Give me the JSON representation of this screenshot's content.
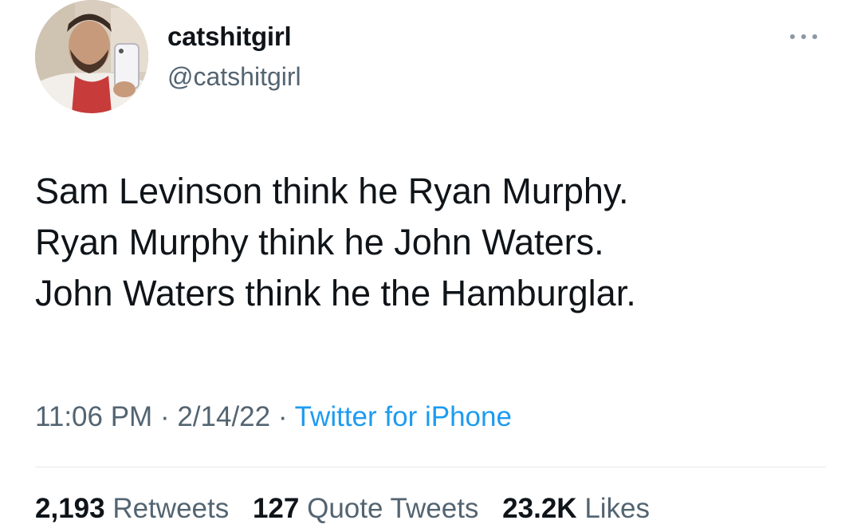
{
  "user": {
    "display_name": "catshitgirl",
    "handle": "@catshitgirl",
    "avatar_icon": "profile-photo"
  },
  "more_icon": "more-dots-icon",
  "tweet": {
    "lines": [
      "Sam Levinson think he Ryan Murphy.",
      "Ryan Murphy think he John Waters.",
      "John Waters think he the Hamburglar."
    ]
  },
  "meta": {
    "time": "11:06 PM",
    "sep1": " · ",
    "date": "2/14/22",
    "sep2": " · ",
    "source": "Twitter for iPhone"
  },
  "stats": {
    "retweets_count": "2,193",
    "retweets_label": "Retweets",
    "quotes_count": "127",
    "quotes_label": "Quote Tweets",
    "likes_count": "23.2K",
    "likes_label": "Likes"
  },
  "colors": {
    "text": "#0f1419",
    "secondary": "#536471",
    "link": "#1d9bf0",
    "divider": "#e6e9eb"
  }
}
